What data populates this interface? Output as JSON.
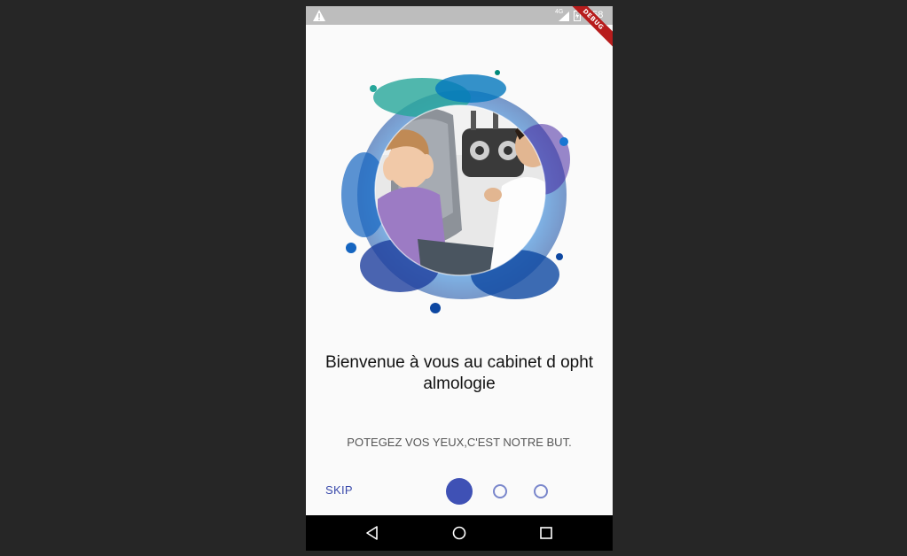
{
  "status_bar": {
    "network": "4G",
    "time": "2:58",
    "debug_banner": "DEBUG"
  },
  "onboarding": {
    "title": "Bienvenue à vous au cabinet d ophtalmologie",
    "subtitle": "POTEGEZ VOS YEUX,C'EST NOTRE BUT.",
    "skip_label": "SKIP",
    "pages_total": 3,
    "current_page": 1,
    "accent_color": "#3f51b5"
  },
  "nav_bar": {
    "icons": [
      "back-icon",
      "home-icon",
      "recents-icon"
    ]
  }
}
